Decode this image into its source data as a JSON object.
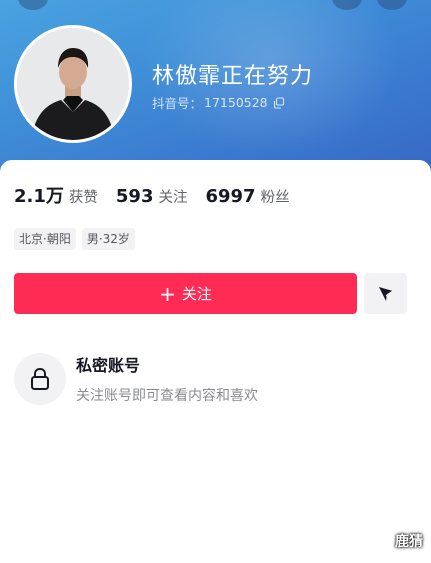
{
  "profile": {
    "nickname": "林傲霏正在努力",
    "uid_label": "抖音号：",
    "uid": "17150528"
  },
  "stats": [
    {
      "value": "2.1万",
      "label": "获赞"
    },
    {
      "value": "593",
      "label": "关注"
    },
    {
      "value": "6997",
      "label": "粉丝"
    }
  ],
  "tags": [
    "北京·朝阳",
    "男·32岁"
  ],
  "actions": {
    "follow_icon": "+",
    "follow_label": "关注",
    "share_icon": "send-arrow-icon"
  },
  "private": {
    "title": "私密账号",
    "desc": "关注账号即可查看内容和喜欢",
    "icon": "lock-icon"
  },
  "watermark": "鹿猜",
  "colors": {
    "accent": "#fe2c55",
    "header_start": "#4aa3e0",
    "header_end": "#3666c4"
  }
}
